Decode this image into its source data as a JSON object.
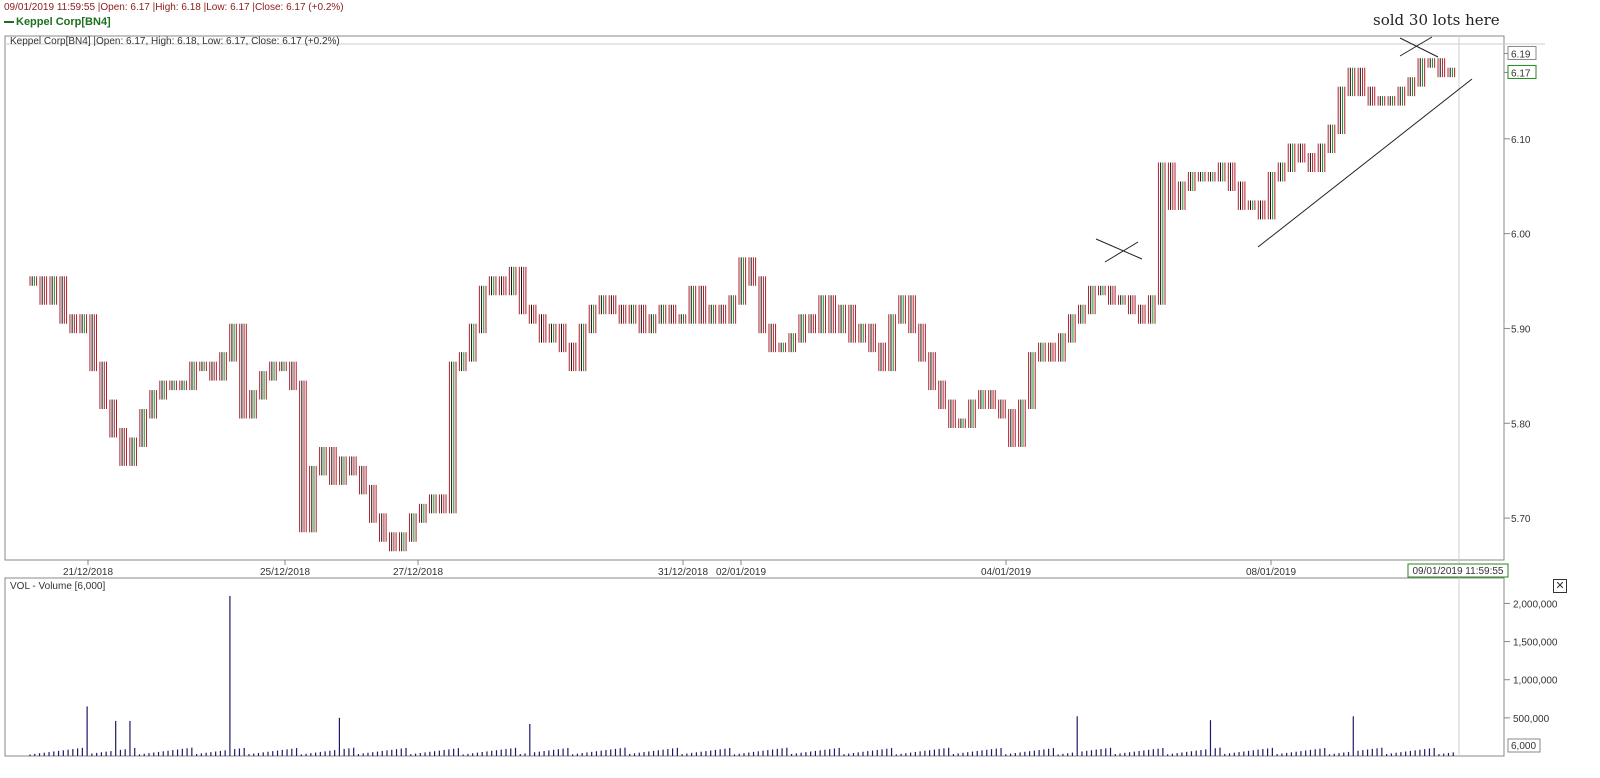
{
  "header": {
    "info_line": "09/01/2019 11:59:55 |Open: 6.17 |High: 6.18 |Low: 6.17 |Close: 6.17 (+0.2%)",
    "legend_tag": "Keppel Corp[BN4]",
    "price_panel_label": "Keppel Corp[BN4] |Open: 6.17, High: 6.18, Low: 6.17, Close: 6.17 (+0.2%)",
    "volume_panel_label": "VOL - Volume [6,000]"
  },
  "annotation": {
    "note_text": "sold 30 lots here"
  },
  "ui": {
    "close_glyph": "✕"
  },
  "colors": {
    "up": "#1f8a1f",
    "down": "#b0202a",
    "grid": "#d8d8d8",
    "volume": "#1a1a66",
    "axis": "#999999"
  },
  "chart_data": [
    {
      "type": "line",
      "title": "Keppel Corp[BN4] |Open: 6.17, High: 6.18, Low: 6.17, Close: 6.17 (+0.2%)",
      "series": [
        {
          "name": "Keppel Corp[BN4]",
          "values": [
            5.95,
            5.93,
            5.95,
            5.91,
            5.9,
            5.91,
            5.86,
            5.82,
            5.79,
            5.76,
            5.78,
            5.81,
            5.83,
            5.84,
            5.84,
            5.84,
            5.86,
            5.86,
            5.85,
            5.87,
            5.9,
            5.81,
            5.83,
            5.85,
            5.86,
            5.86,
            5.84,
            5.69,
            5.75,
            5.77,
            5.74,
            5.76,
            5.75,
            5.73,
            5.7,
            5.68,
            5.67,
            5.68,
            5.7,
            5.71,
            5.72,
            5.71,
            5.86,
            5.87,
            5.9,
            5.94,
            5.95,
            5.94,
            5.96,
            5.92,
            5.91,
            5.89,
            5.9,
            5.88,
            5.86,
            5.9,
            5.92,
            5.93,
            5.92,
            5.91,
            5.92,
            5.9,
            5.91,
            5.92,
            5.91,
            5.91,
            5.94,
            5.91,
            5.92,
            5.91,
            5.93,
            5.97,
            5.95,
            5.9,
            5.88,
            5.88,
            5.89,
            5.91,
            5.9,
            5.93,
            5.9,
            5.92,
            5.89,
            5.9,
            5.88,
            5.86,
            5.91,
            5.93,
            5.9,
            5.87,
            5.84,
            5.82,
            5.8,
            5.8,
            5.82,
            5.83,
            5.82,
            5.81,
            5.78,
            5.82,
            5.87,
            5.88,
            5.87,
            5.89,
            5.91,
            5.92,
            5.94,
            5.94,
            5.93,
            5.93,
            5.92,
            5.91,
            5.93,
            6.07,
            6.03,
            6.05,
            6.06,
            6.06,
            6.06,
            6.07,
            6.05,
            6.03,
            6.03,
            6.02,
            6.06,
            6.07,
            6.09,
            6.08,
            6.07,
            6.09,
            6.11,
            6.15,
            6.17,
            6.15,
            6.14,
            6.14,
            6.14,
            6.15,
            6.16,
            6.18,
            6.18,
            6.17,
            6.17
          ]
        }
      ],
      "yticks": [
        6.19,
        6.17,
        6.1,
        6.0,
        5.9,
        5.8,
        5.7
      ],
      "ylim": [
        5.66,
        6.2
      ],
      "xticks": [
        "21/12/2018",
        "25/12/2018",
        "27/12/2018",
        "31/12/2018",
        "02/01/2019",
        "04/01/2019",
        "08/01/2019"
      ],
      "last_time_label": "09/01/2019 11:59:55",
      "annotations": [
        "sold 30 lots here"
      ]
    },
    {
      "type": "bar",
      "title": "VOL - Volume [6,000]",
      "yticks": [
        "2,000,000",
        "1,500,000",
        "1,000,000",
        "500,000"
      ],
      "ytick_values": [
        2000000,
        1500000,
        1000000,
        500000
      ],
      "ylim": [
        0,
        2150000
      ],
      "last_value_label": "6,000",
      "spikes": [
        {
          "index": 12,
          "value": 650000
        },
        {
          "index": 18,
          "value": 460000
        },
        {
          "index": 21,
          "value": 460000
        },
        {
          "index": 42,
          "value": 2100000
        },
        {
          "index": 65,
          "value": 500000
        },
        {
          "index": 105,
          "value": 420000
        },
        {
          "index": 220,
          "value": 520000
        },
        {
          "index": 248,
          "value": 470000
        },
        {
          "index": 278,
          "value": 520000
        }
      ]
    }
  ]
}
